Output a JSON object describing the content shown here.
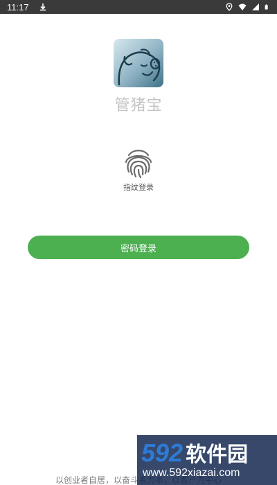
{
  "status_bar": {
    "time": "11:17",
    "icons": [
      "download-icon",
      "location-icon",
      "wifi-icon",
      "signal-icon",
      "battery-icon"
    ]
  },
  "app": {
    "name": "管猪宝",
    "icon": "pig-logo-icon",
    "brand_color": "#4caf50"
  },
  "fingerprint": {
    "label": "指纹登录",
    "icon": "fingerprint-icon"
  },
  "password_login": {
    "label": "密码登录"
  },
  "footer": {
    "slogan": "以创业者自居，以奋斗者为本，以客户为中心"
  },
  "watermark": {
    "logo_num": "592",
    "logo_cn": "软件园",
    "url": "www.592xiazai.com"
  }
}
